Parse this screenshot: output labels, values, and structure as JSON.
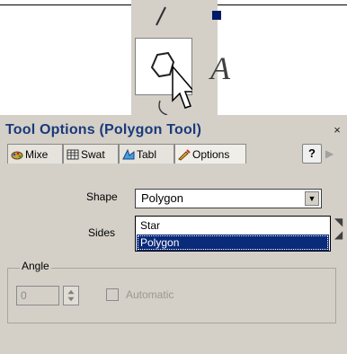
{
  "toolbox": {
    "pencil_icon": "pencil-icon",
    "polygon_icon": "polygon-tool-icon",
    "text_icon": "text-tool-icon",
    "text_glyph": "A",
    "cursor_icon": "mouse-pointer-icon"
  },
  "panel": {
    "title": "Tool Options (Polygon Tool)",
    "close_glyph": "×",
    "help_glyph": "?",
    "scroll_glyph": "▶"
  },
  "tabs": [
    {
      "label": "Mixe",
      "icon": "mixer-icon"
    },
    {
      "label": "Swat",
      "icon": "swatches-icon"
    },
    {
      "label": "Tabl",
      "icon": "table-icon"
    },
    {
      "label": "Options",
      "icon": "options-icon"
    }
  ],
  "shape": {
    "label": "Shape",
    "value": "Polygon",
    "options": [
      "Star",
      "Polygon"
    ],
    "selected_option": "Polygon"
  },
  "sides": {
    "label": "Sides"
  },
  "angle": {
    "group_label": "Angle",
    "value": "0",
    "automatic_label": "Automatic"
  },
  "colors": {
    "title": "#1a3a7a",
    "selection": "#0a2a7a",
    "panel_bg": "#d4d0c8"
  }
}
